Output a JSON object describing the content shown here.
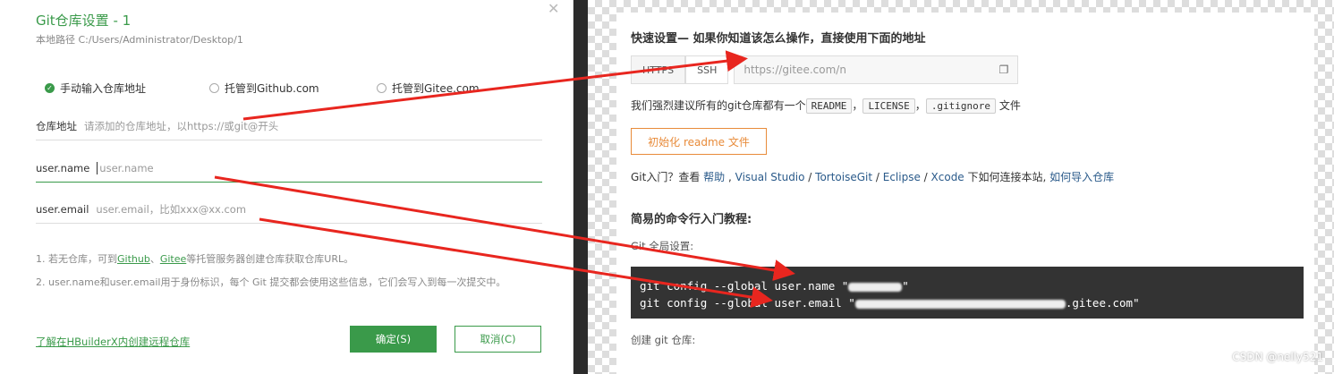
{
  "dialog": {
    "title": "Git仓库设置 - 1",
    "local_path": "本地路径 C:/Users/Administrator/Desktop/1",
    "radios": [
      {
        "label": "手动输入仓库地址",
        "checked": true
      },
      {
        "label": "托管到Github.com",
        "checked": false
      },
      {
        "label": "托管到Gitee.com",
        "checked": false
      }
    ],
    "repo_label": "仓库地址",
    "repo_placeholder": "请添加的仓库地址，以https://或git@开头",
    "name_label": "user.name",
    "name_placeholder": "user.name",
    "email_label": "user.email",
    "email_placeholder": "user.email，比如xxx@xx.com",
    "note1_prefix": "1. 若无仓库，可到",
    "note1_github": "Github",
    "note1_sep": "、",
    "note1_gitee": "Gitee",
    "note1_suffix": "等托管服务器创建仓库获取仓库URL。",
    "note2": "2. user.name和user.email用于身份标识，每个 Git 提交都会使用这些信息，它们会写入到每一次提交中。",
    "learn_link": "了解在HBuilderX内创建远程仓库",
    "ok_button": "确定(S)",
    "cancel_button": "取消(C)",
    "close_glyph": "✕"
  },
  "gitee": {
    "quick_setup": "快速设置— 如果你知道该怎么操作，直接使用下面的地址",
    "https_tab": "HTTPS",
    "ssh_tab": "SSH",
    "url": "https://gitee.com/n",
    "suggest_prefix": "我们强烈建议所有的git仓库都有一个",
    "readme": "README",
    "license": "LICENSE",
    "gitignore": ".gitignore",
    "suggest_suffix": "文件",
    "comma1": "，",
    "comma2": "，",
    "init_button": "初始化 readme 文件",
    "git_intro": "Git入门？查看 ",
    "help": "帮助",
    "vs": "Visual Studio",
    "tortoise": "TortoiseGit",
    "eclipse": "Eclipse",
    "xcode": "Xcode",
    "connect_text": " 下如何连接本站, ",
    "import": "如何导入仓库",
    "sep_comma": " , ",
    "slash": " / ",
    "tutorial_title": "简易的命令行入门教程:",
    "global_setup": "Git 全局设置:",
    "cmd1": "git config --global user.name \"",
    "cmd1_end": "\"",
    "cmd2": "git config --global user.email \"",
    "cmd2_end": ".gitee.com\"",
    "create_repo": "创建 git 仓库:"
  },
  "watermark": "CSDN @nelly521",
  "colors": {
    "accent": "#3a9a4a",
    "arrow": "#e8261f",
    "init_orange": "#e88b3a"
  }
}
